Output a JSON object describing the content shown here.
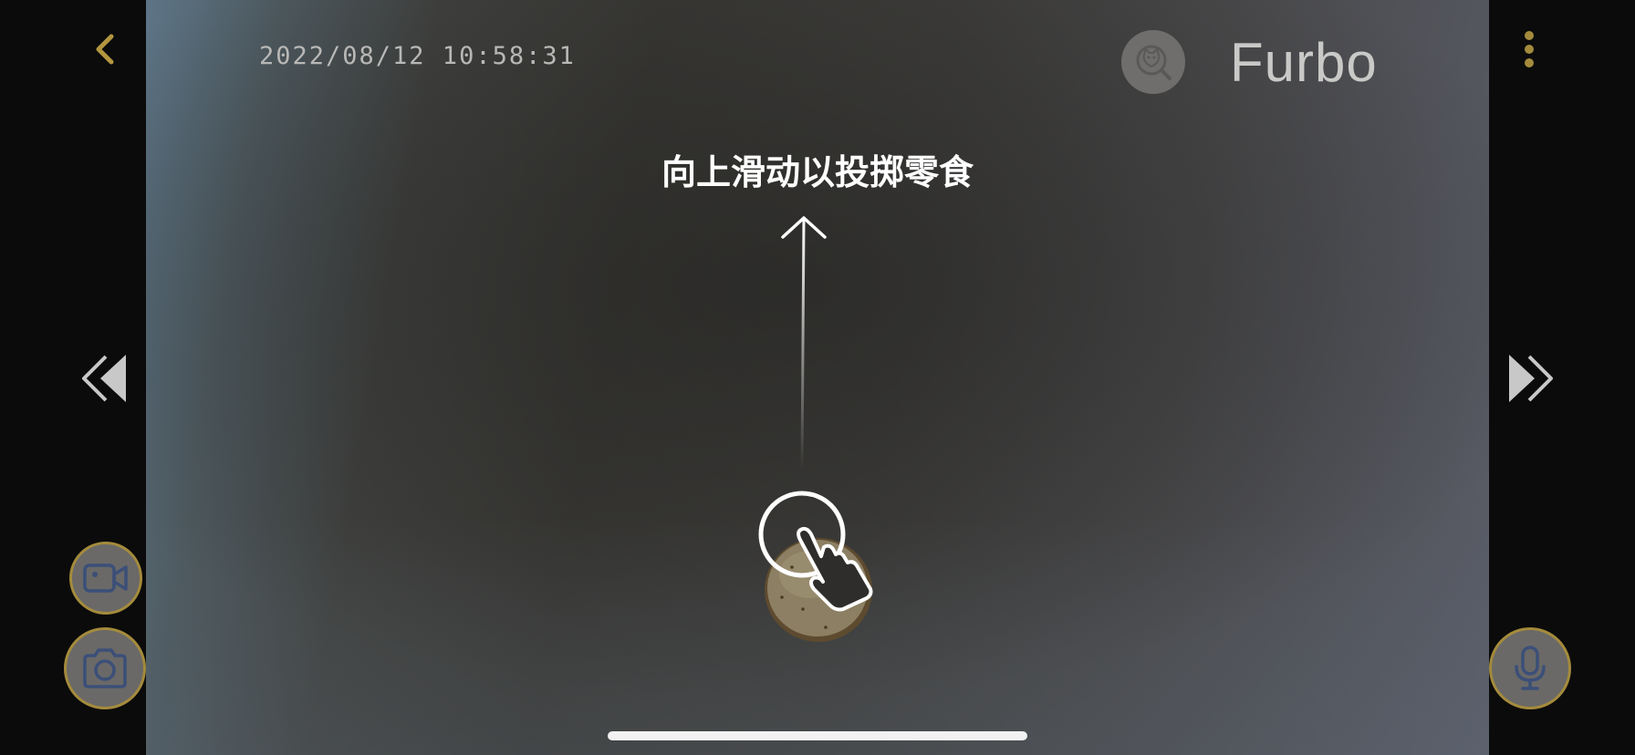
{
  "header": {
    "timestamp": "2022/08/12  10:58:31",
    "brand": "Furbo"
  },
  "overlay": {
    "hint": "向上滑动以投掷零食"
  },
  "icons": {
    "back": "chevron-left-icon",
    "more": "more-vertical-icon",
    "dog_face": "dog-face-search-icon",
    "prev": "double-chevron-left-icon",
    "next": "double-chevron-right-icon",
    "record": "video-camera-icon",
    "snapshot": "camera-icon",
    "mic": "microphone-icon",
    "swipe": "swipe-up-hand-icon",
    "treat": "treat-icon"
  },
  "colors": {
    "accent_gold": "#a48b3c",
    "button_fill": "#6a6968",
    "icon_blue": "#3b4f78"
  }
}
